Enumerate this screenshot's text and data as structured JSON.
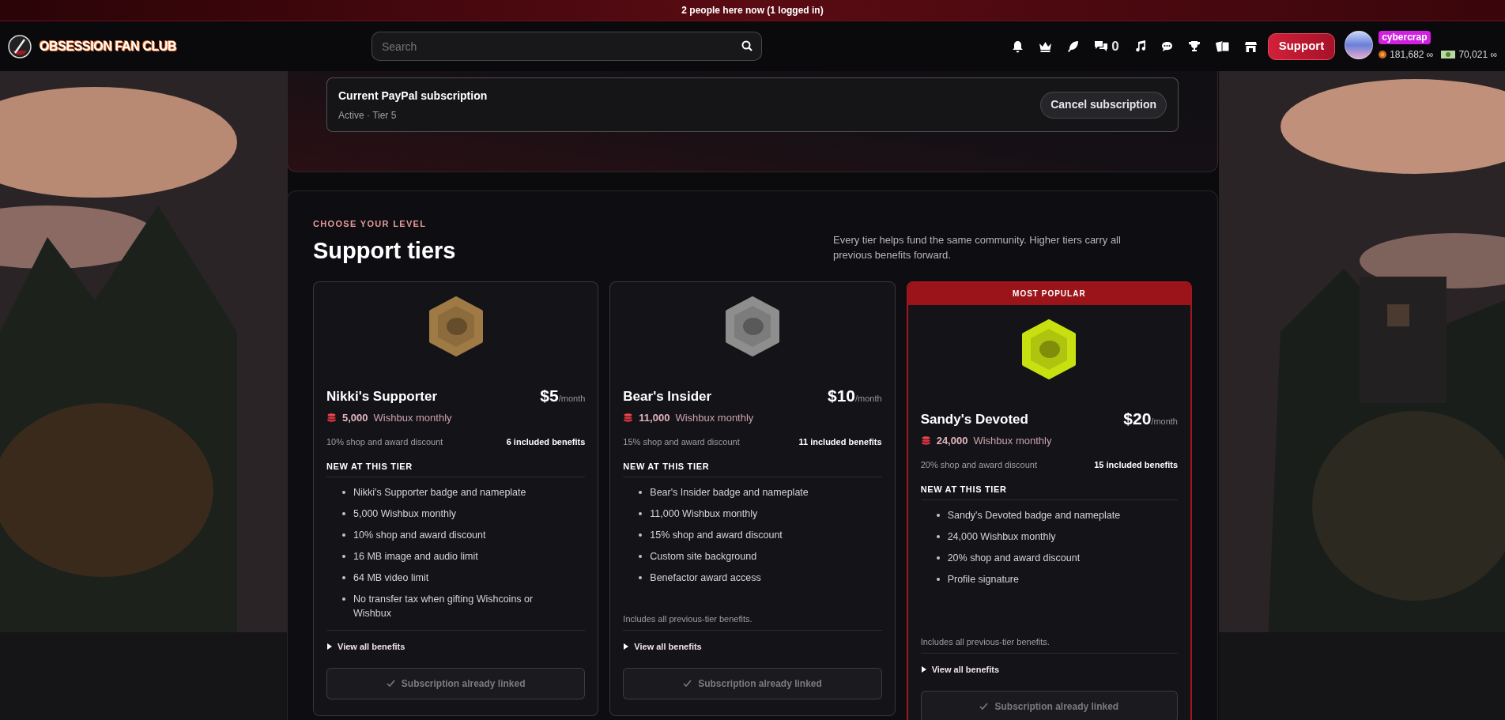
{
  "presence_banner": "2 people here now (1 logged in)",
  "header": {
    "logo": "OBSESSION FAN CLUB",
    "search": {
      "placeholder": "Search"
    },
    "messages_count": "0",
    "support_button": "Support",
    "user": {
      "name": "cybercrap",
      "coins": "181,682 ∞",
      "bucks": "70,021 ∞"
    }
  },
  "subscription": {
    "title": "Current PayPal subscription",
    "status": "Active · Tier 5",
    "cancel_button": "Cancel subscription"
  },
  "tiers_section": {
    "eyebrow": "CHOOSE YOUR LEVEL",
    "title": "Support tiers",
    "description": "Every tier helps fund the same community. Higher tiers carry all previous benefits forward."
  },
  "tiers": [
    {
      "color": "#a07a45",
      "name": "Nikki's Supporter",
      "price": "$5",
      "period": "/month",
      "wishbux_amount": "5,000",
      "wishbux_label": "Wishbux monthly",
      "discount": "10% shop and award discount",
      "benefit_count": "6 included benefits",
      "new_heading": "NEW AT THIS TIER",
      "benefits": [
        "Nikki's Supporter badge and nameplate",
        "5,000 Wishbux monthly",
        "10% shop and award discount",
        "16 MB image and audio limit",
        "64 MB video limit",
        "No transfer tax when gifting Wishcoins or Wishbux"
      ],
      "view_all": {
        "label": "View all benefits",
        "expanded": false
      },
      "action": {
        "label": "Subscription already linked",
        "disabled": true
      }
    },
    {
      "color": "#8e8e8e",
      "name": "Bear's Insider",
      "price": "$10",
      "period": "/month",
      "wishbux_amount": "11,000",
      "wishbux_label": "Wishbux monthly",
      "discount": "15% shop and award discount",
      "benefit_count": "11 included benefits",
      "new_heading": "NEW AT THIS TIER",
      "benefits": [
        "Bear's Insider badge and nameplate",
        "11,000 Wishbux monthly",
        "15% shop and award discount",
        "Custom site background",
        "Benefactor award access"
      ],
      "note": "Includes all previous-tier benefits.",
      "view_all": {
        "label": "View all benefits",
        "expanded": false
      },
      "action": {
        "label": "Subscription already linked",
        "disabled": true
      }
    },
    {
      "popular_label": "MOST POPULAR",
      "color": "#c8e010",
      "name": "Sandy's Devoted",
      "price": "$20",
      "period": "/month",
      "wishbux_amount": "24,000",
      "wishbux_label": "Wishbux monthly",
      "discount": "20% shop and award discount",
      "benefit_count": "15 included benefits",
      "new_heading": "NEW AT THIS TIER",
      "benefits": [
        "Sandy's Devoted badge and nameplate",
        "24,000 Wishbux monthly",
        "20% shop and award discount",
        "Profile signature"
      ],
      "note": "Includes all previous-tier benefits.",
      "view_all": {
        "label": "View all benefits",
        "expanded": false
      },
      "action": {
        "label": "Subscription already linked",
        "disabled": true
      }
    }
  ]
}
